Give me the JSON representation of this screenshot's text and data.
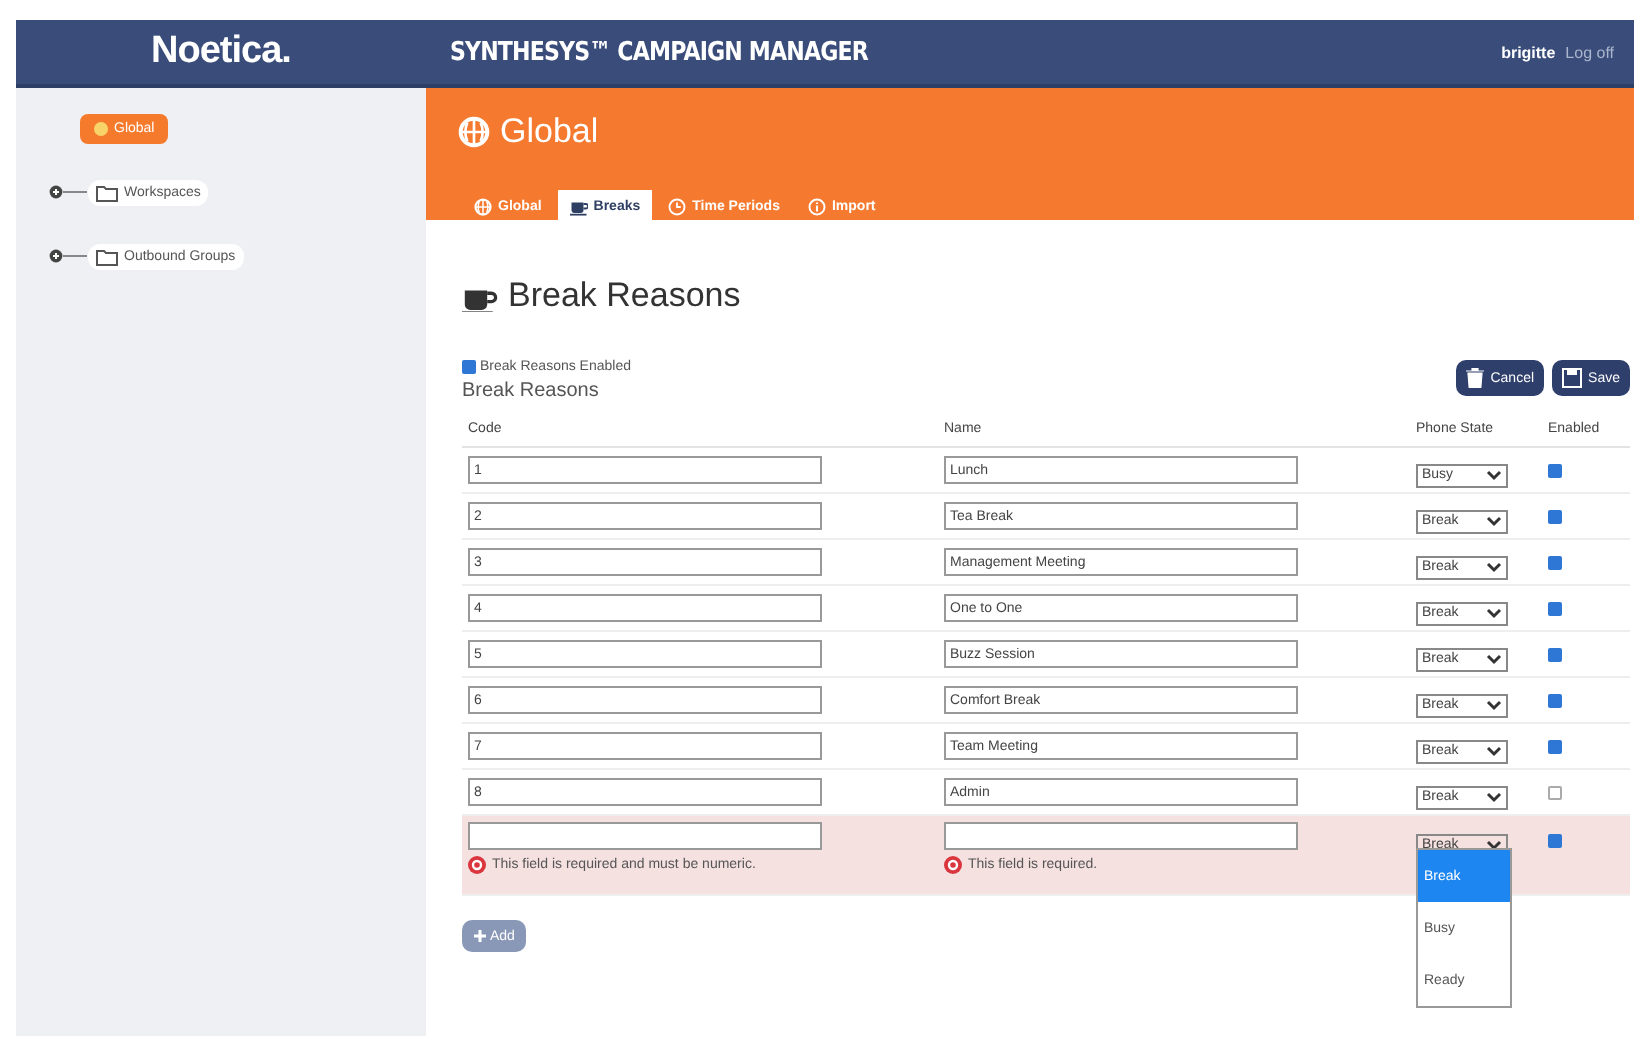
{
  "header": {
    "logo": "Noetica.",
    "title": "SYNTHESYS™ CAMPAIGN MANAGER",
    "user": "brigitte",
    "logoff": "Log off"
  },
  "sidebar": {
    "items": [
      {
        "label": "Global",
        "kind": "root",
        "selected": true
      },
      {
        "label": "Workspaces",
        "kind": "folder",
        "selected": false
      },
      {
        "label": "Outbound Groups",
        "kind": "folder",
        "selected": false
      }
    ]
  },
  "section": {
    "title": "Global",
    "tabs": [
      {
        "label": "Global",
        "kind": "globe",
        "selected": false
      },
      {
        "label": "Breaks",
        "kind": "cup",
        "selected": true
      },
      {
        "label": "Time Periods",
        "kind": "clock",
        "selected": false
      },
      {
        "label": "Import",
        "kind": "info",
        "selected": false
      }
    ]
  },
  "panel": {
    "heading": "Break Reasons",
    "enabled_toggle": {
      "label": "Break Reasons Enabled",
      "checked": true
    },
    "buttons": [
      {
        "label": "Cancel",
        "kind": "cancel"
      },
      {
        "label": "Save",
        "kind": "save"
      }
    ],
    "subheading": "Break Reasons",
    "columns": [
      "Code",
      "Name",
      "Phone State",
      "Enabled"
    ],
    "rows": [
      {
        "code": "1",
        "name": "Lunch",
        "phone_state": "Busy",
        "enabled": true,
        "invalid": false
      },
      {
        "code": "2",
        "name": "Tea Break",
        "phone_state": "Break",
        "enabled": true,
        "invalid": false
      },
      {
        "code": "3",
        "name": "Management Meeting",
        "phone_state": "Break",
        "enabled": true,
        "invalid": false
      },
      {
        "code": "4",
        "name": "One to One",
        "phone_state": "Break",
        "enabled": true,
        "invalid": false
      },
      {
        "code": "5",
        "name": "Buzz Session",
        "phone_state": "Break",
        "enabled": true,
        "invalid": false
      },
      {
        "code": "6",
        "name": "Comfort Break",
        "phone_state": "Break",
        "enabled": true,
        "invalid": false
      },
      {
        "code": "7",
        "name": "Team Meeting",
        "phone_state": "Break",
        "enabled": true,
        "invalid": false
      },
      {
        "code": "8",
        "name": "Admin",
        "phone_state": "Break",
        "enabled": false,
        "invalid": false
      },
      {
        "phone_state": "Break",
        "enabled": true,
        "invalid": true,
        "code_error": "This field is required and must be numeric.",
        "name_error": "This field is required.",
        "dropdown": [
          {
            "label": "Break",
            "selected": true
          },
          {
            "label": "Busy",
            "selected": false
          },
          {
            "label": "Ready",
            "selected": false
          }
        ]
      }
    ],
    "add_button": "Add"
  }
}
